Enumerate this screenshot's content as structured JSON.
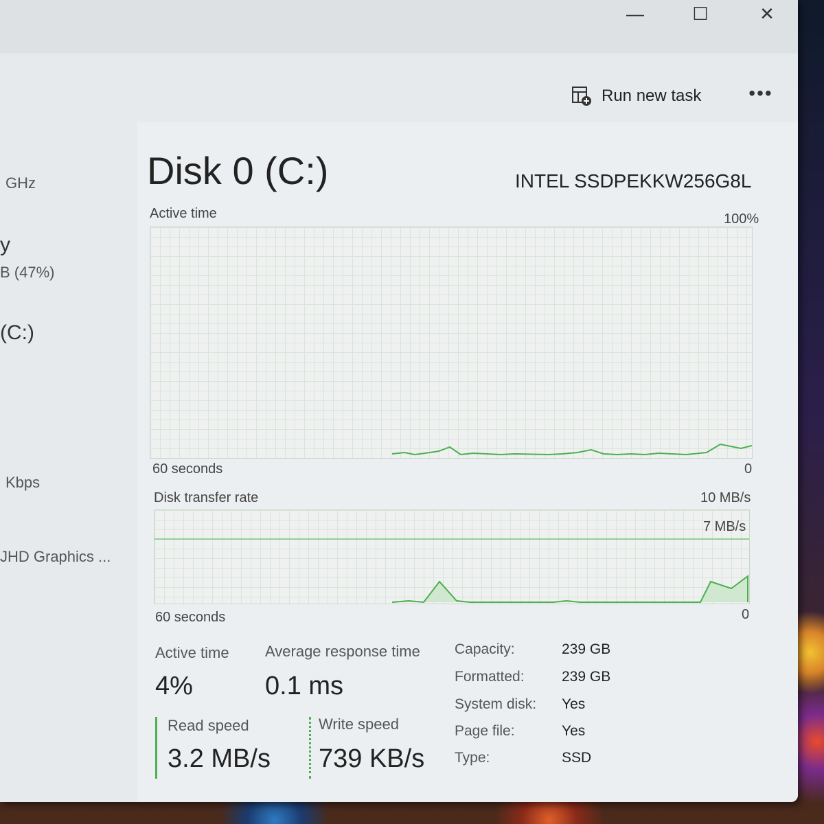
{
  "window_controls": {
    "minimize": "—",
    "maximize": "☐",
    "close": "✕"
  },
  "toolbar": {
    "run_new_task": "Run new task",
    "more": "•••"
  },
  "sidebar": {
    "cpu_speed": "GHz",
    "memory_title": "y",
    "memory_value": "B (47%)",
    "disk_title": "(C:)",
    "network_value": "Kbps",
    "gpu_value": "JHD Graphics ..."
  },
  "disk": {
    "title": "Disk 0 (C:)",
    "model": "INTEL SSDPEKKW256G8L",
    "active_time_graph": {
      "label": "Active time",
      "max_label": "100%",
      "time_label": "60 seconds",
      "min_label": "0"
    },
    "transfer_graph": {
      "label": "Disk transfer rate",
      "max_label": "10 MB/s",
      "mid_label": "7 MB/s",
      "time_label": "60 seconds",
      "min_label": "0"
    },
    "stats": {
      "active_time_label": "Active time",
      "active_time_value": "4%",
      "avg_response_label": "Average response time",
      "avg_response_value": "0.1 ms",
      "read_speed_label": "Read speed",
      "read_speed_value": "3.2 MB/s",
      "write_speed_label": "Write speed",
      "write_speed_value": "739 KB/s"
    },
    "info": [
      {
        "label": "Capacity:",
        "value": "239 GB"
      },
      {
        "label": "Formatted:",
        "value": "239 GB"
      },
      {
        "label": "System disk:",
        "value": "Yes"
      },
      {
        "label": "Page file:",
        "value": "Yes"
      },
      {
        "label": "Type:",
        "value": "SSD"
      }
    ]
  },
  "colors": {
    "graph_line": "#4caf50",
    "read_bar": "#4caf50"
  }
}
